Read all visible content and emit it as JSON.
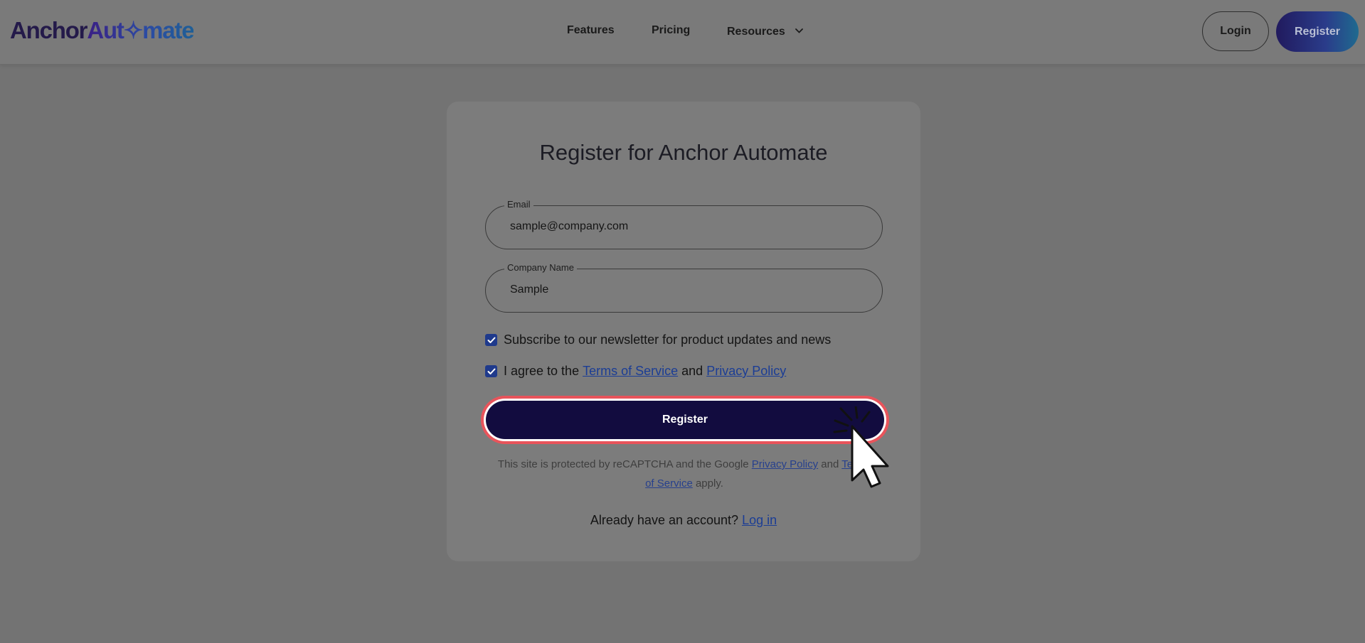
{
  "header": {
    "logo_part1": "Anchor",
    "logo_part2": "Aut✧mate",
    "nav": {
      "features": "Features",
      "pricing": "Pricing",
      "resources": "Resources"
    },
    "login_label": "Login",
    "register_label": "Register"
  },
  "form": {
    "title": "Register for Anchor Automate",
    "email": {
      "label": "Email",
      "value": "sample@company.com"
    },
    "company": {
      "label": "Company Name",
      "value": "Sample"
    },
    "newsletter": {
      "label": "Subscribe to our newsletter for product updates and news",
      "checked": true
    },
    "agree": {
      "prefix": "I agree to the",
      "terms": "Terms of Service",
      "and": "and",
      "privacy": "Privacy Policy",
      "checked": true
    },
    "submit_label": "Register",
    "recaptcha": {
      "text1": "This site is protected by reCAPTCHA and the Google",
      "privacy": "Privacy Policy",
      "and": "and",
      "terms_part1": "Terms",
      "terms_part2": "of Service",
      "apply": "apply."
    },
    "login_prompt": {
      "text": "Already have an account?",
      "link": "Log in"
    }
  },
  "colors": {
    "overlay_bg": "#737373",
    "submit_bg": "#120c3f",
    "highlight_ring": "#e8545b",
    "link": "#1b3d95",
    "checkbox": "#1f3a8c"
  }
}
